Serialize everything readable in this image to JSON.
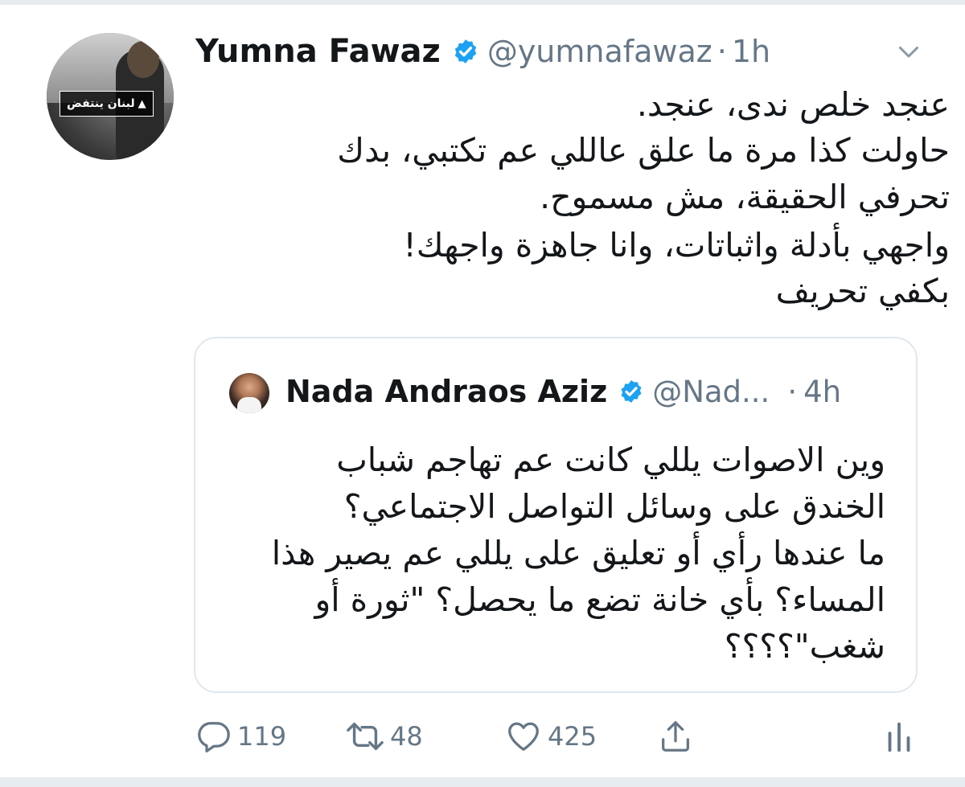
{
  "tweet": {
    "author": {
      "name": "Yumna Fawaz",
      "handle": "@yumnafawaz",
      "time": "1h",
      "verified": true,
      "avatar_banner_text": "لبنان ينتفض"
    },
    "separator": "·",
    "text_lines": [
      "عنجد خلص ندى، عنجد.",
      "حاولت كذا مرة ما علق عاللي عم تكتبي، بدك",
      "تحرفي الحقيقة، مش مسموح.",
      "واجهي بأدلة واثباتات، وانا جاهزة واجهك!",
      "بكفي تحريف"
    ]
  },
  "quoted_tweet": {
    "author": {
      "name": "Nada Andraos Aziz",
      "handle": "@Nad...",
      "time": "4h",
      "verified": true
    },
    "separator": "·",
    "text_lines": [
      "وين الاصوات يللي كانت عم تهاجم شباب",
      "الخندق على وسائل التواصل الاجتماعي؟",
      "ما عندها رأي أو تعليق على يللي عم يصير هذا",
      "المساء؟ بأي خانة تضع ما يحصل؟ \"ثورة أو",
      "شغب\"؟؟؟؟"
    ]
  },
  "actions": {
    "reply_count": "119",
    "retweet_count": "48",
    "like_count": "425"
  },
  "colors": {
    "verified_blue": "#1da1f2",
    "muted_gray": "#657786",
    "text": "#14171a",
    "border": "#e1e8ed"
  },
  "icons": [
    "verified-badge-icon",
    "chevron-down-icon",
    "reply-icon",
    "retweet-icon",
    "like-icon",
    "share-icon",
    "analytics-icon"
  ]
}
